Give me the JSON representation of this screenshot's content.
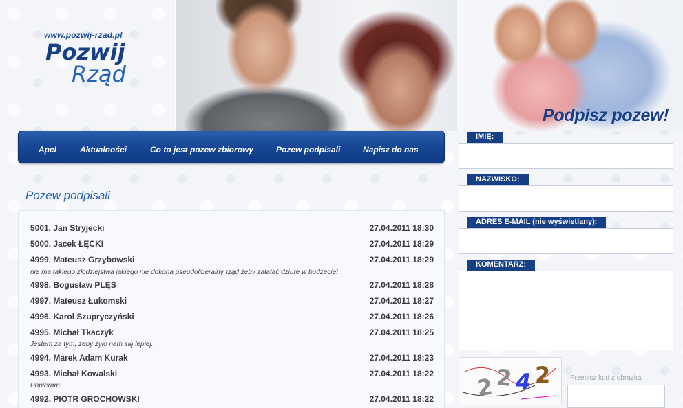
{
  "header": {
    "site_url": "www.pozwij-rzad.pl",
    "logo_line1": "Pozwij",
    "logo_line2": "Rząd",
    "sign_title": "Podpisz pozew!"
  },
  "nav": {
    "items": [
      {
        "label": "Apel"
      },
      {
        "label": "Aktualności"
      },
      {
        "label": "Co to jest pozew zbiorowy"
      },
      {
        "label": "Pozew podpisali"
      },
      {
        "label": "Napisz do nas"
      }
    ]
  },
  "main": {
    "section_title": "Pozew podpisali",
    "signers": [
      {
        "entry": "5001.  Jan Stryjecki",
        "date": "27.04.2011 18:30"
      },
      {
        "entry": "5000.  Jacek ŁĘCKI",
        "date": "27.04.2011 18:29"
      },
      {
        "entry": "4999.  Mateusz Grzybowski",
        "date": "27.04.2011 18:29",
        "comment": "nie ma takiego złodziejstwa jakiego nie dokona pseudoliberalny rząd żeby załatać dziure w budżecie!"
      },
      {
        "entry": "4998.  Bogusław PLĘS",
        "date": "27.04.2011 18:28"
      },
      {
        "entry": "4997.  Mateusz Łukomski",
        "date": "27.04.2011 18:27"
      },
      {
        "entry": "4996.  Karol Szupryczyński",
        "date": "27.04.2011 18:26"
      },
      {
        "entry": "4995.  Michał Tkaczyk",
        "date": "27.04.2011 18:25",
        "comment": "Jestem za tym, żeby żyło nam się lepiej."
      },
      {
        "entry": "4994.  Marek Adam Kurak",
        "date": "27.04.2011 18:23"
      },
      {
        "entry": "4993.  Michał Kowalski",
        "date": "27.04.2011 18:22",
        "comment": "Popieram!"
      },
      {
        "entry": "4992.  PIOTR GROCHOWSKI",
        "date": "27.04.2011 18:22"
      }
    ]
  },
  "form": {
    "first_name_label": "IMIĘ:",
    "last_name_label": "NAZWISKO:",
    "email_label": "ADRES E-MAIL (nie wyświetlany):",
    "comment_label": "KOMENTARZ:",
    "captcha_code": [
      "2",
      "2",
      "4",
      "2"
    ],
    "captcha_hint": "Przepisz kod z obrazka:"
  },
  "colors": {
    "brand_dark": "#163f86",
    "brand_light": "#2663b5",
    "nav_bg": "#184896"
  }
}
